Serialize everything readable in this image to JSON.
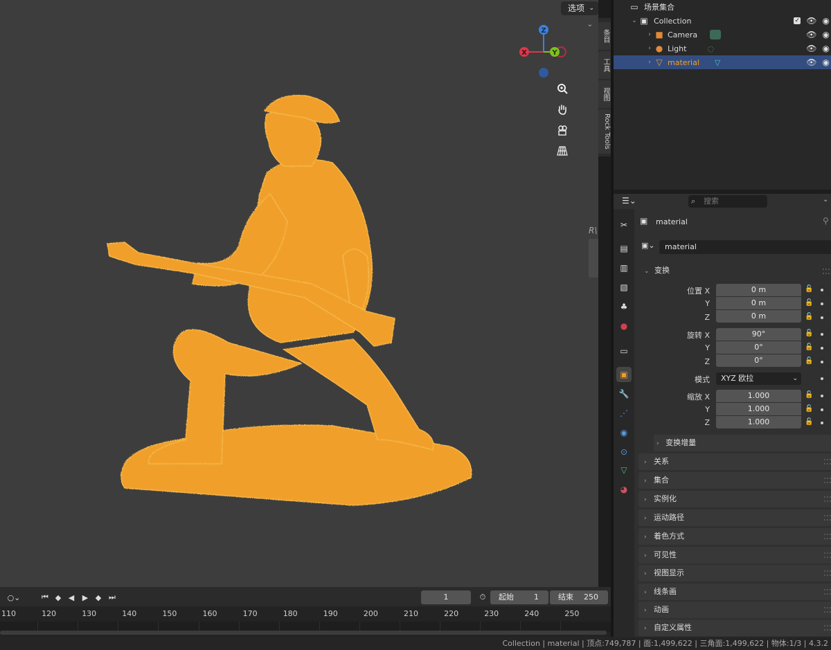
{
  "viewport": {
    "options_label": "选项",
    "side_letter": "R\\",
    "npanel_tabs": [
      "条目",
      "工具",
      "视图",
      "Rock Tools"
    ],
    "gizmo": {
      "z": "Z",
      "x": "X",
      "y": "Y"
    },
    "nav_icons": [
      "zoom-icon",
      "hand-pan-icon",
      "camera-icon",
      "perspective-grid-icon"
    ]
  },
  "outliner": {
    "scene_collection": "场景集合",
    "rows": [
      {
        "label": "Collection",
        "icon": "collection-icon"
      },
      {
        "label": "Camera",
        "icon": "camera-icon"
      },
      {
        "label": "Light",
        "icon": "light-icon"
      },
      {
        "label": "material",
        "icon": "mesh-icon"
      }
    ]
  },
  "properties": {
    "search_placeholder": "搜索",
    "object_name": "material",
    "datablock_name": "material",
    "transform_header": "变换",
    "location_label": "位置 X",
    "rotation_label": "旋转 X",
    "scale_label": "缩放 X",
    "axis_y": "Y",
    "axis_z": "Z",
    "location": [
      "0 m",
      "0 m",
      "0 m"
    ],
    "rotation": [
      "90°",
      "0°",
      "0°"
    ],
    "mode_label": "模式",
    "mode_value": "XYZ 欧拉",
    "scale": [
      "1.000",
      "1.000",
      "1.000"
    ],
    "delta_transform": "变换增量",
    "panels": [
      "关系",
      "集合",
      "实例化",
      "运动路径",
      "着色方式",
      "可见性",
      "视图显示",
      "线条画",
      "动画",
      "自定义属性"
    ]
  },
  "timeline": {
    "current_frame": "1",
    "start_label": "起始",
    "start_value": "1",
    "end_label": "结束",
    "end_value": "250",
    "ticks": [
      "110",
      "120",
      "130",
      "140",
      "150",
      "160",
      "170",
      "180",
      "190",
      "200",
      "210",
      "220",
      "230",
      "240",
      "250"
    ]
  },
  "status": {
    "text": "Collection | material | 顶点:749,787 | 面:1,499,622 | 三角面:1,499,622 | 物体:1/3 | 4.3.2"
  },
  "colors": {
    "accent_selected": "#334d80",
    "model_orange": "#f0a02a",
    "axis_x": "#e0364a",
    "axis_y": "#7ec21e",
    "axis_z": "#3a83e0"
  }
}
